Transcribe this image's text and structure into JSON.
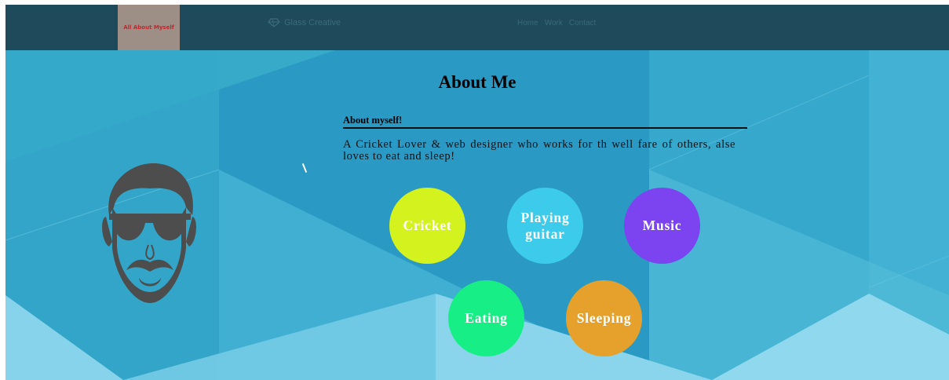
{
  "nav": {
    "logo_text": "All About Myself",
    "brand": "Glass Creative",
    "brand_icon": "diamond-icon",
    "links": [
      "Home",
      "Work",
      "Contact"
    ]
  },
  "main": {
    "title": "About Me",
    "subheading": "About myself!",
    "paragraph": "A Cricket Lover & web designer who works for th well fare of others, alse loves to eat and sleep!"
  },
  "hobbies": [
    {
      "label": "Cricket",
      "color": "#d4f21e"
    },
    {
      "label": "Playing guitar",
      "color": "#3ccbea"
    },
    {
      "label": "Music",
      "color": "#7b44f0"
    },
    {
      "label": "Eating",
      "color": "#17ee85"
    },
    {
      "label": "Sleeping",
      "color": "#e5a12b"
    }
  ],
  "avatar_icon": "bearded-man-sunglasses-icon",
  "colors": {
    "nav": "#1e4a5b",
    "background": "#2299c6",
    "text": "#000000"
  }
}
